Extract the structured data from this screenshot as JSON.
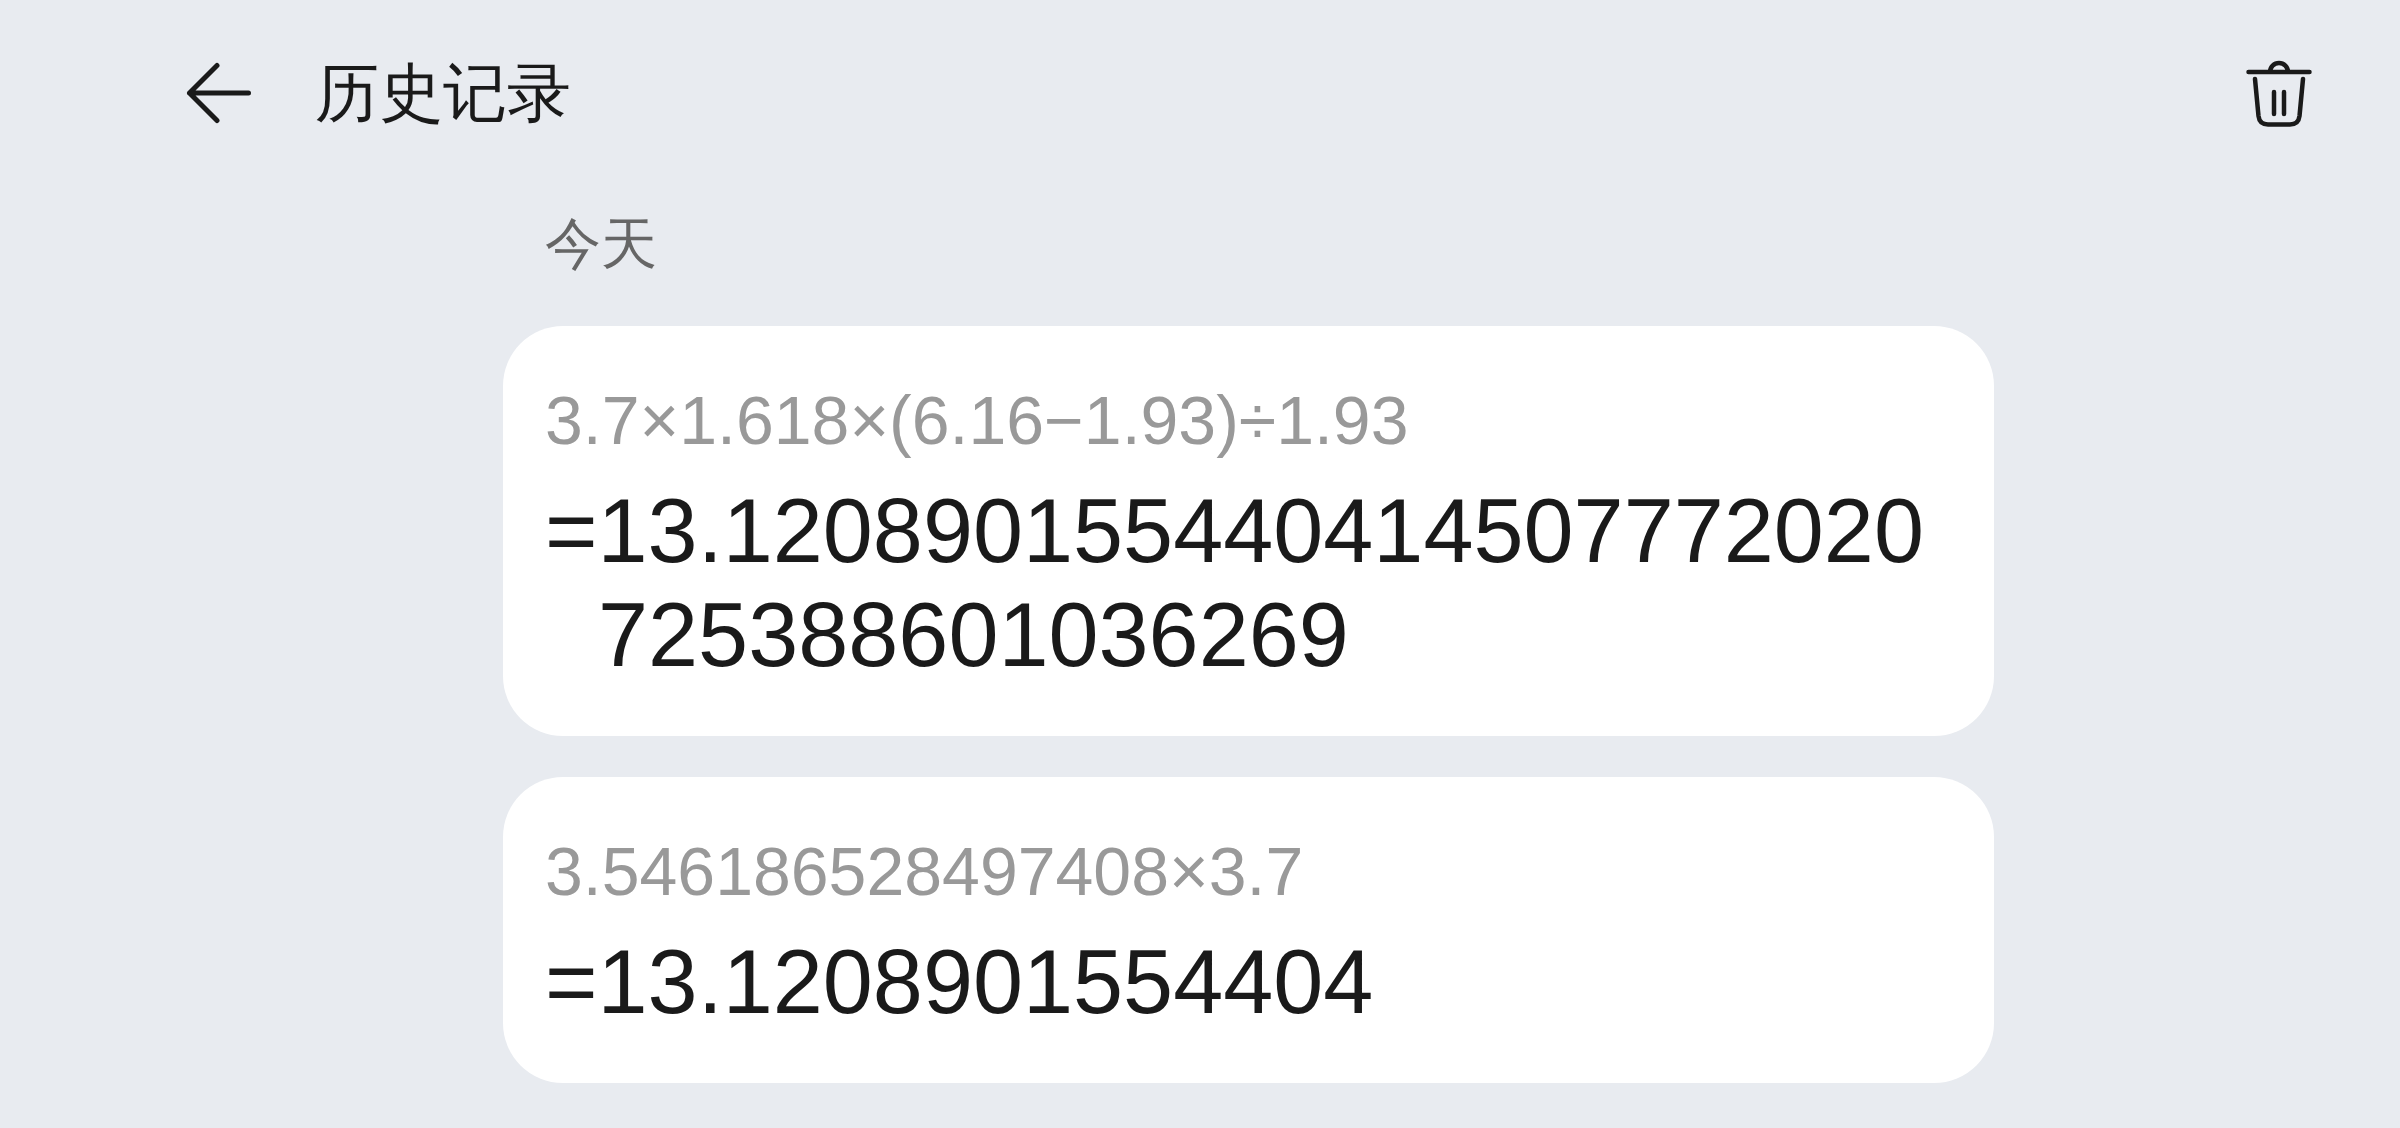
{
  "header": {
    "title": "历史记录"
  },
  "groups": [
    {
      "label": "今天",
      "entries": [
        {
          "expression": "3.7×1.618×(6.16−1.93)÷1.93",
          "result": "=13.120890155440414507772020725388601036269"
        },
        {
          "expression": "3.546186528497408×3.7",
          "result": "=13.1208901554404"
        }
      ]
    }
  ]
}
